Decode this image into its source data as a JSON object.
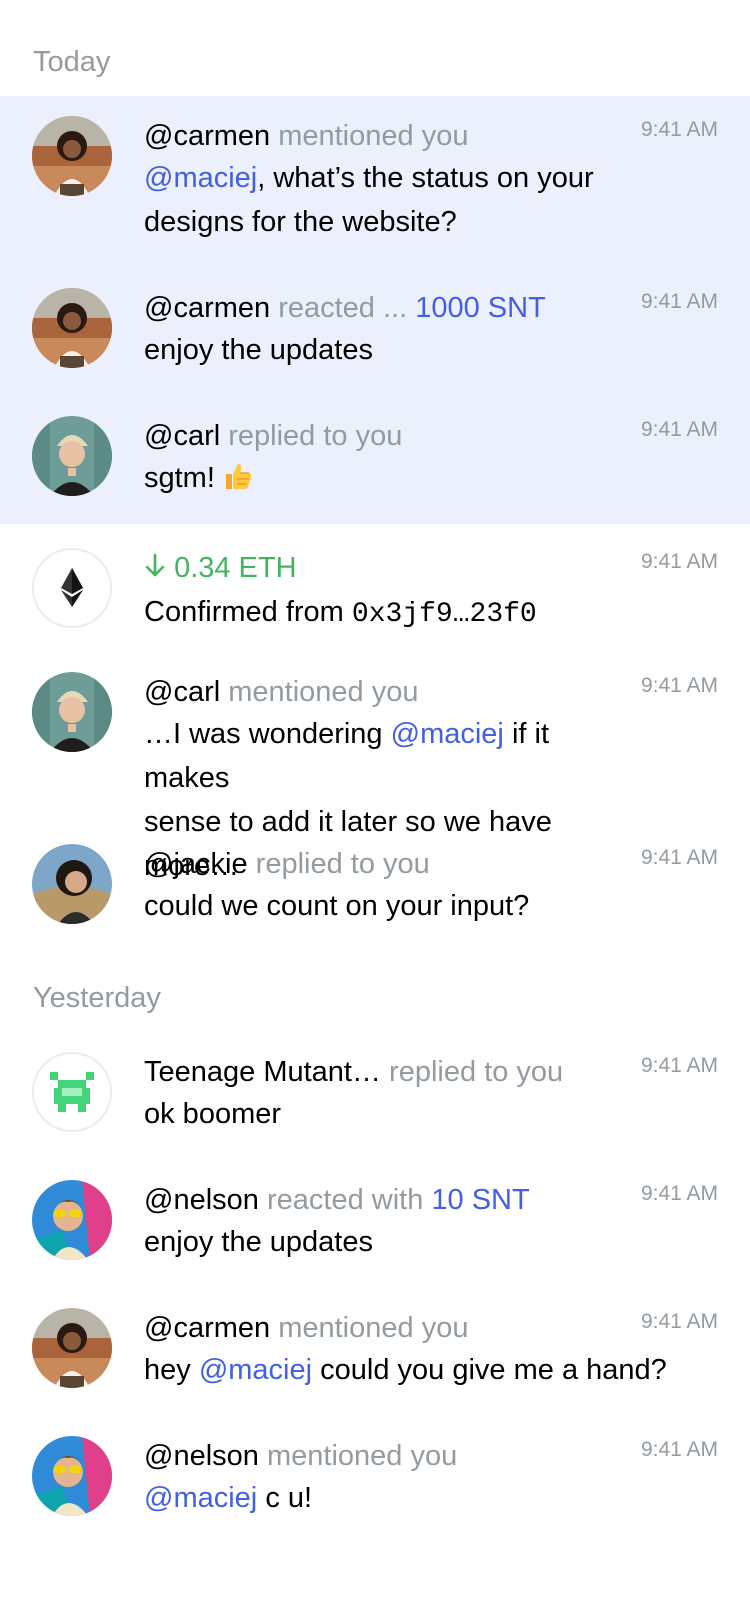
{
  "sections": {
    "today": "Today",
    "yesterday": "Yesterday"
  },
  "colors": {
    "unread_bg": "#ECEFFC",
    "accent": "#4360DF",
    "muted": "#939BA1",
    "success": "#44B461"
  },
  "notifications": [
    {
      "avatar": "carmen-avatar",
      "name": "@carmen",
      "action": "mentioned you",
      "time": "9:41 AM",
      "mention": "@maciej",
      "text_after": ", what’s the status on your",
      "text_line2": "designs for the website?",
      "unread": true
    },
    {
      "avatar": "carmen-avatar",
      "name": "@carmen",
      "action": "reacted ...",
      "amount": "1000 SNT",
      "time": "9:41 AM",
      "text": "enjoy the updates",
      "unread": true
    },
    {
      "avatar": "carl-avatar",
      "name": "@carl",
      "action": "replied to you",
      "time": "9:41 AM",
      "text": "sgtm!",
      "emoji": "thumbs-up-emoji",
      "unread": true
    },
    {
      "avatar": "ethereum-icon",
      "direction_icon": "arrow-down-icon",
      "amount": "0.34 ETH",
      "time": "9:41 AM",
      "text_prefix": "Confirmed from",
      "address": "0x3jf9…23f0"
    },
    {
      "avatar": "carl-avatar",
      "name": "@carl",
      "action": "mentioned you",
      "time": "9:41 AM",
      "text_before": "…I was wondering",
      "mention": "@maciej",
      "text_after": "if it makes",
      "text_line2": "sense to add it later so we have more…"
    },
    {
      "avatar": "jackie-avatar",
      "name": "@jackie",
      "action": "replied to you",
      "time": "9:41 AM",
      "text": "could we count on your input?"
    },
    {
      "avatar": "community-pixel-avatar",
      "name": "Teenage Mutant…",
      "action": "replied to you",
      "time": "9:41 AM",
      "text": "ok boomer"
    },
    {
      "avatar": "nelson-avatar",
      "name": "@nelson",
      "action": "reacted with",
      "amount": "10 SNT",
      "time": "9:41 AM",
      "text": "enjoy the updates"
    },
    {
      "avatar": "carmen-avatar",
      "name": "@carmen",
      "action": "mentioned you",
      "time": "9:41 AM",
      "text_before": "hey",
      "mention": "@maciej",
      "text_after": "could you give me a hand?"
    },
    {
      "avatar": "nelson-avatar",
      "name": "@nelson",
      "action": "mentioned you",
      "time": "9:41 AM",
      "mention": "@maciej",
      "text_after": "c u!"
    }
  ]
}
